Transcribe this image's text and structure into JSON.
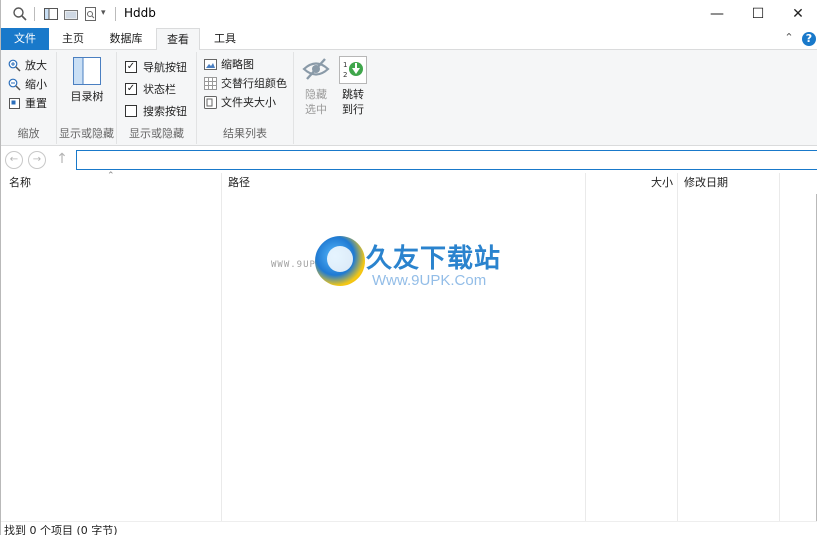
{
  "window": {
    "title": "Hddb",
    "minimize_icon": "minimize-icon",
    "maximize_icon": "maximize-icon",
    "close_icon": "close-icon",
    "min_glyph": "—",
    "max_glyph": "☐",
    "close_glyph": "✕"
  },
  "quick_access": {
    "icons": [
      "search-icon",
      "layout-icon",
      "folder-icon",
      "find-file-icon",
      "dropdown-icon"
    ]
  },
  "ribbon_tabs": {
    "file": "文件",
    "home": "主页",
    "database": "数据库",
    "view": "查看",
    "tools": "工具",
    "active": "查看"
  },
  "ribbon": {
    "zoom_group": {
      "label": "缩放",
      "zoom_in": "放大",
      "zoom_out": "缩小",
      "reset": "重置"
    },
    "tree_group": {
      "label": "显示或隐藏",
      "tree_button": "目录树"
    },
    "panels_group": {
      "label": "显示或隐藏",
      "nav_buttons": "导航按钮",
      "status_bar": "状态栏",
      "search_button": "搜索按钮",
      "nav_buttons_checked": true,
      "status_bar_checked": true,
      "search_button_checked": false
    },
    "results_group": {
      "label": "结果列表",
      "thumbnails": "缩略图",
      "alternate_colors": "交替行组颜色",
      "folder_size": "文件夹大小"
    },
    "hide_button": {
      "line1": "隐藏",
      "line2": "选中"
    },
    "jump_button": {
      "line1": "跳转",
      "line2": "到行"
    }
  },
  "address": {
    "value": ""
  },
  "columns": {
    "name": "名称",
    "path": "路径",
    "size": "大小",
    "modified": "修改日期"
  },
  "watermark": {
    "cn": "久友下载站",
    "en": "Www.9UPK.Com",
    "url": "WWW.9UPK.COM"
  },
  "status": {
    "text": "找到 0 个项目 (0 字节)"
  },
  "colors": {
    "accent": "#1979ca",
    "ribbon_bg": "#f5f6f7"
  }
}
